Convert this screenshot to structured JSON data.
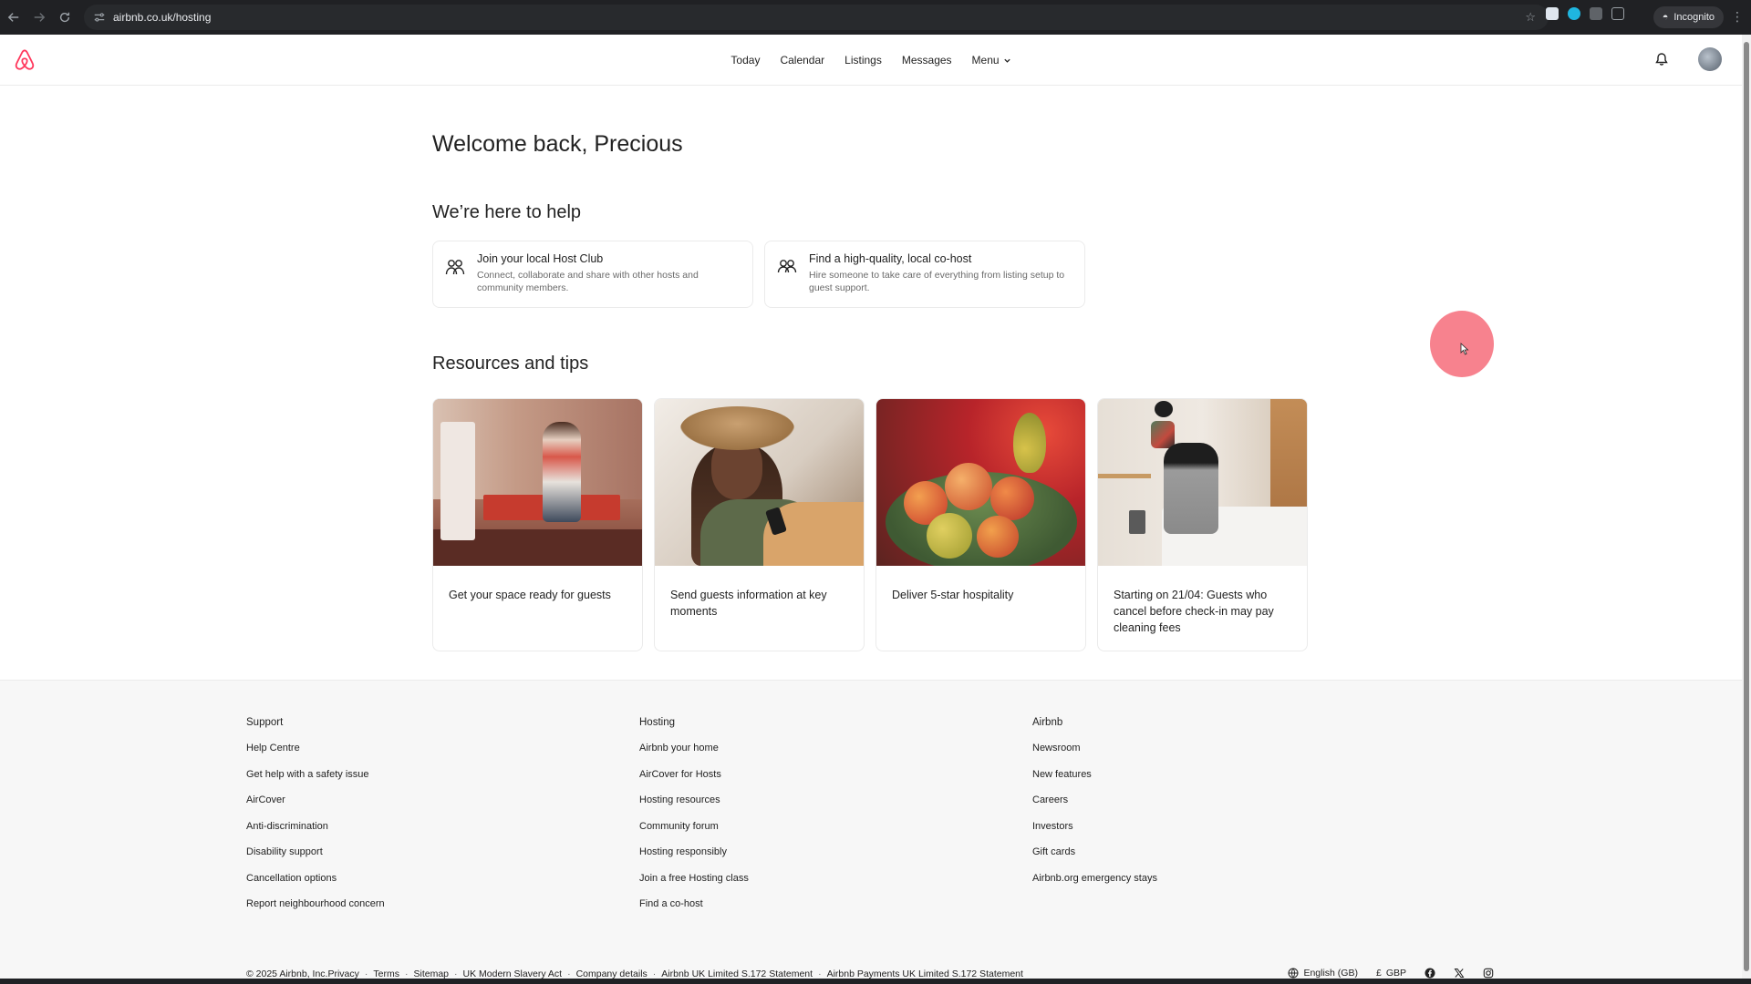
{
  "browser": {
    "url": "airbnb.co.uk/hosting",
    "incognito_label": "Incognito"
  },
  "header": {
    "nav": [
      {
        "label": "Today"
      },
      {
        "label": "Calendar"
      },
      {
        "label": "Listings"
      },
      {
        "label": "Messages"
      },
      {
        "label": "Menu"
      }
    ]
  },
  "main": {
    "welcome": "Welcome back, Precious",
    "help_title": "We’re here to help",
    "help_cards": [
      {
        "title": "Join your local Host Club",
        "desc": "Connect, collaborate and share with other hosts and community members."
      },
      {
        "title": "Find a high-quality, local co-host",
        "desc": "Hire someone to take care of everything from listing setup to guest support."
      }
    ],
    "resources_title": "Resources and tips",
    "resources": [
      {
        "label": "Get your space ready for guests"
      },
      {
        "label": "Send guests information at key moments"
      },
      {
        "label": "Deliver 5-star hospitality"
      },
      {
        "label": "Starting on 21/04: Guests who cancel before check-in may pay cleaning fees"
      }
    ]
  },
  "footer": {
    "columns": [
      {
        "heading": "Support",
        "links": [
          "Help Centre",
          "Get help with a safety issue",
          "AirCover",
          "Anti-discrimination",
          "Disability support",
          "Cancellation options",
          "Report neighbourhood concern"
        ]
      },
      {
        "heading": "Hosting",
        "links": [
          "Airbnb your home",
          "AirCover for Hosts",
          "Hosting resources",
          "Community forum",
          "Hosting responsibly",
          "Join a free Hosting class",
          "Find a co-host"
        ]
      },
      {
        "heading": "Airbnb",
        "links": [
          "Newsroom",
          "New features",
          "Careers",
          "Investors",
          "Gift cards",
          "Airbnb.org emergency stays"
        ]
      }
    ],
    "legal": {
      "copyright": "© 2025 Airbnb, Inc.",
      "links": [
        "Privacy",
        "Terms",
        "Sitemap",
        "UK Modern Slavery Act",
        "Company details",
        "Airbnb UK Limited S.172 Statement",
        "Airbnb Payments UK Limited S.172 Statement"
      ]
    },
    "language": "English (GB)",
    "currency_symbol": "£",
    "currency": "GBP"
  },
  "colors": {
    "brand": "#ff385c",
    "text": "#222222",
    "muted": "#6a6a6a",
    "footer_bg": "#f7f7f7",
    "cursor_highlight": "#f55f6e"
  }
}
